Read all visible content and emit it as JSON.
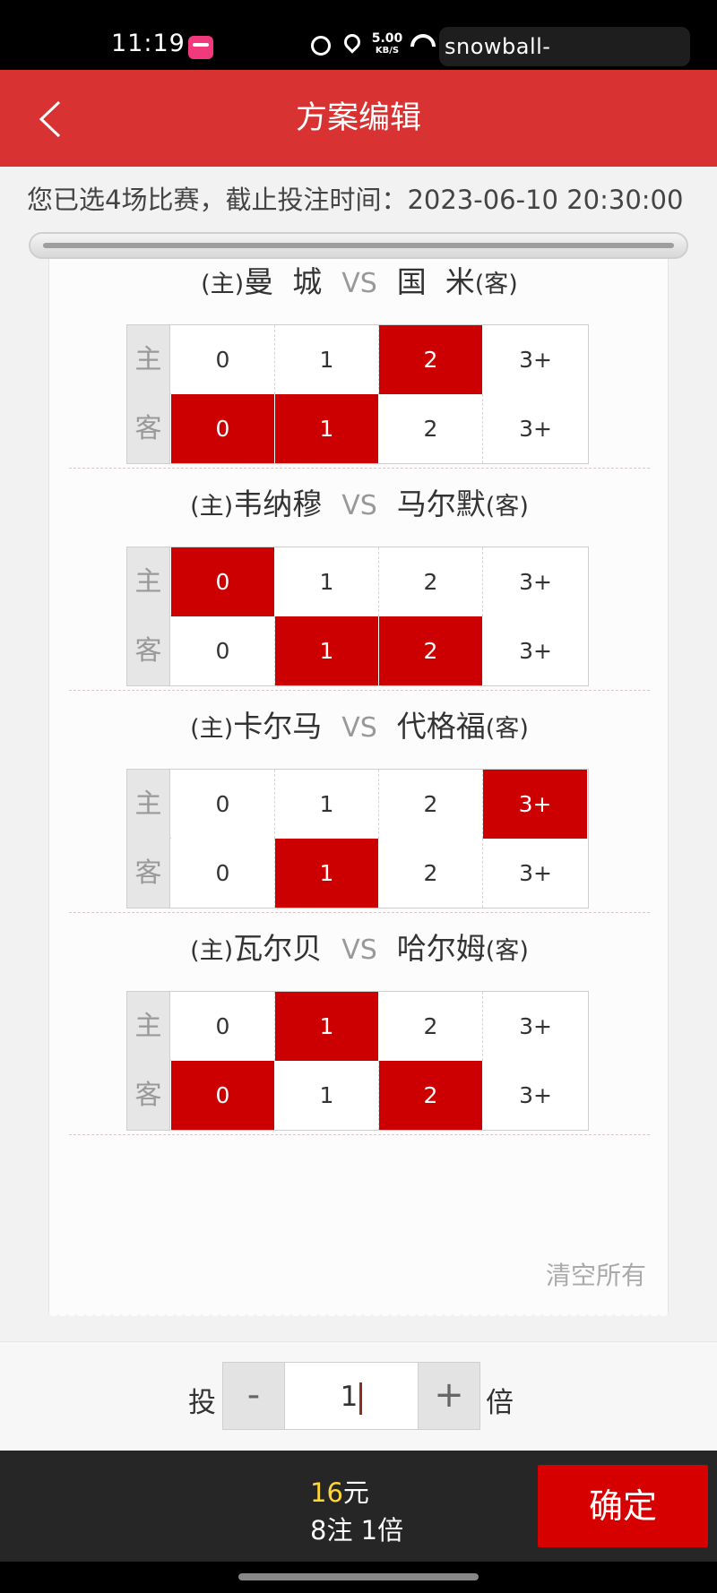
{
  "status_bar": {
    "time": "11:19",
    "net_speed_value": "5.00",
    "net_speed_unit": "KB/S",
    "watermark": "snowball-gunqiu.com.cn"
  },
  "header": {
    "title": "方案编辑"
  },
  "info": {
    "text": "您已选4场比赛，截止投注时间：2023-06-10 20:30:00"
  },
  "labels": {
    "home_tag": "(主)",
    "away_tag": "(客)",
    "vs": "VS",
    "home_side": "主",
    "away_side": "客"
  },
  "options": [
    "0",
    "1",
    "2",
    "3+"
  ],
  "matches": [
    {
      "home": "曼  城",
      "away": "国  米",
      "home_selected": [
        false,
        false,
        true,
        false
      ],
      "away_selected": [
        true,
        true,
        false,
        false
      ]
    },
    {
      "home": "韦纳穆",
      "away": "马尔默",
      "home_selected": [
        true,
        false,
        false,
        false
      ],
      "away_selected": [
        false,
        true,
        true,
        false
      ]
    },
    {
      "home": "卡尔马",
      "away": "代格福",
      "home_selected": [
        false,
        false,
        false,
        true
      ],
      "away_selected": [
        false,
        true,
        false,
        false
      ]
    },
    {
      "home": "瓦尔贝",
      "away": "哈尔姆",
      "home_selected": [
        false,
        true,
        false,
        false
      ],
      "away_selected": [
        true,
        false,
        true,
        false
      ]
    }
  ],
  "clear_all": "清空所有",
  "multiplier": {
    "label_before": "投",
    "minus": "-",
    "value": "1",
    "plus": "+",
    "label_after": "倍"
  },
  "bottom": {
    "amount": "16",
    "currency": "元",
    "summary": "8注 1倍",
    "confirm": "确定"
  },
  "colors": {
    "header": "#d83232",
    "selected": "#cc0000",
    "amount": "#ffd633",
    "confirm": "#d60000"
  }
}
